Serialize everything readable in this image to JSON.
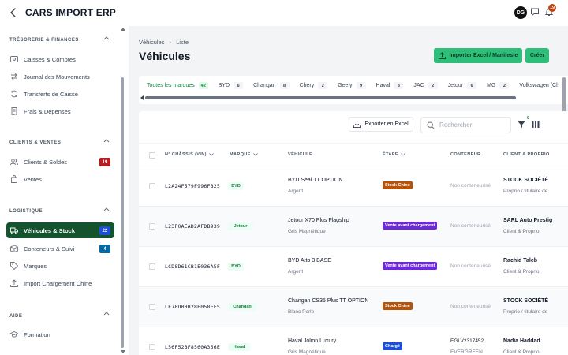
{
  "header": {
    "app_title": "CARS IMPORT ERP",
    "avatar_initials": "DG",
    "notifications_count": "19"
  },
  "sidebar": {
    "sections": [
      {
        "title": "TRÉSORERIE & FINANCES",
        "items": [
          {
            "label": "Caisses & Comptes",
            "icon": "cash-icon"
          },
          {
            "label": "Journal des Mouvements",
            "icon": "transfer-arrows-icon"
          },
          {
            "label": "Transferts de Caisse",
            "icon": "refresh-icon"
          },
          {
            "label": "Frais & Dépenses",
            "icon": "receipt-icon"
          }
        ]
      },
      {
        "title": "CLIENTS & VENTES",
        "items": [
          {
            "label": "Clients & Soldes",
            "icon": "users-icon",
            "badge": "19"
          },
          {
            "label": "Ventes",
            "icon": "shopping-bag-icon"
          }
        ]
      },
      {
        "title": "LOGISTIQUE",
        "items": [
          {
            "label": "Véhicules & Stock",
            "icon": "truck-icon",
            "badge": "22",
            "active": true
          },
          {
            "label": "Conteneurs & Suivi",
            "icon": "container-icon",
            "badge": "4"
          },
          {
            "label": "Marques",
            "icon": "tag-icon"
          },
          {
            "label": "Import Chargement Chine",
            "icon": "upload-icon"
          }
        ]
      },
      {
        "title": "AIDE",
        "items": [
          {
            "label": "Formation",
            "icon": "graduation-cap-icon"
          }
        ]
      }
    ]
  },
  "main": {
    "breadcrumb": [
      "Véhicules",
      "Liste"
    ],
    "title": "Véhicules",
    "import_button": "Importer Excel / Manifeste",
    "create_button": "Créer",
    "brand_tabs": [
      {
        "label": "Toutes les marques",
        "count": "42",
        "active": true
      },
      {
        "label": "BYD",
        "count": "6"
      },
      {
        "label": "Changan",
        "count": "8"
      },
      {
        "label": "Chery",
        "count": "2"
      },
      {
        "label": "Geely",
        "count": "9"
      },
      {
        "label": "Haval",
        "count": "3"
      },
      {
        "label": "JAC",
        "count": "2"
      },
      {
        "label": "Jetour",
        "count": "6"
      },
      {
        "label": "MG",
        "count": "2"
      },
      {
        "label": "Volkswagen (Ch",
        "count": ""
      }
    ],
    "export_button": "Exporter en Excel",
    "search_placeholder": "Rechercher",
    "filter_count": "0",
    "columns": [
      "N° CHÂSSIS (VIN)",
      "MARQUE",
      "VÉHICULE",
      "ÉTAPE",
      "CONTENEUR",
      "CLIENT & PROPRIO"
    ],
    "rows": [
      {
        "vin": "L2A24F579F996FB25",
        "brand": "BYD",
        "vehicle": "BYD Seal TT OPTION",
        "color": "Argent",
        "stage": "Stock Chine",
        "container": "Non conteneurisé",
        "container_sub": "",
        "client": "STOCK SOCIÉTÉ",
        "client_sub": "Proprio / titulaire de"
      },
      {
        "vin": "L23F0AEAD2AFDB939",
        "brand": "Jetour",
        "vehicle": "Jetour X70 Plus Flagship",
        "color": "Gris Magnétique",
        "stage": "Vente avant chargement",
        "container": "Non conteneurisé",
        "container_sub": "",
        "client": "SARL Auto Prestig",
        "client_sub": "Client & Proprio"
      },
      {
        "vin": "LCD8D61CB1E036A5F",
        "brand": "BYD",
        "vehicle": "BYD Atto 3 BASE",
        "color": "Argent",
        "stage": "Vente avant chargement",
        "container": "Non conteneurisé",
        "container_sub": "",
        "client": "Rachid Taleb",
        "client_sub": "Client & Proprio"
      },
      {
        "vin": "LE78D00B28E058EF5",
        "brand": "Changan",
        "vehicle": "Changan CS35 Plus TT OPTION",
        "color": "Blanc Perle",
        "stage": "Stock Chine",
        "container": "Non conteneurisé",
        "container_sub": "",
        "client": "STOCK SOCIÉTÉ",
        "client_sub": "Proprio / titulaire de"
      },
      {
        "vin": "L56F52BF8560A356E",
        "brand": "Haval",
        "vehicle": "Haval Jolion Luxury",
        "color": "Gris Magnétique",
        "stage": "Chargé",
        "container": "EGLV2317452",
        "container_sub": "EVERGREEN",
        "client": "Nadia Haddad",
        "client_sub": "Client & Proprio"
      }
    ],
    "stage_colors": {
      "Stock Chine": "#b45309",
      "Vente avant chargement": "#6d28d9",
      "Chargé": "#1d4ed8"
    }
  }
}
